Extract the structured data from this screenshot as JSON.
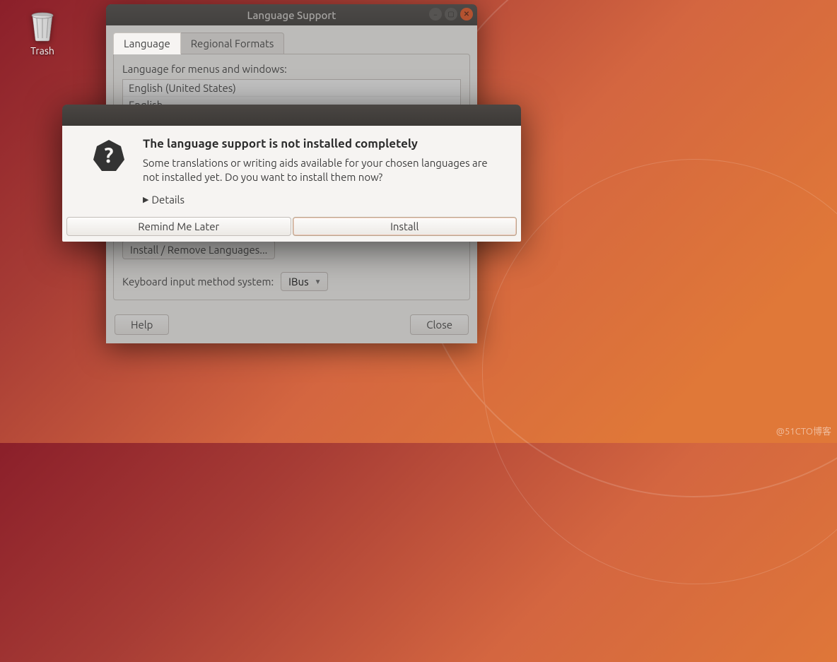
{
  "desktop": {
    "trash_label": "Trash"
  },
  "lang_window": {
    "title": "Language Support",
    "tabs": {
      "language": "Language",
      "regional": "Regional Formats"
    },
    "menus_label": "Language for menus and windows:",
    "languages": [
      "English (United States)",
      "English"
    ],
    "install_remove_btn": "Install / Remove Languages...",
    "keyboard_label": "Keyboard input method system:",
    "keyboard_value": "IBus",
    "help_btn": "Help",
    "close_btn": "Close"
  },
  "modal": {
    "heading": "The language support is not installed completely",
    "body": "Some translations or writing aids available for your chosen languages are not installed yet. Do you want to install them now?",
    "details_label": "Details",
    "remind_btn": "Remind Me Later",
    "install_btn": "Install"
  },
  "watermark": "@51CTO博客"
}
